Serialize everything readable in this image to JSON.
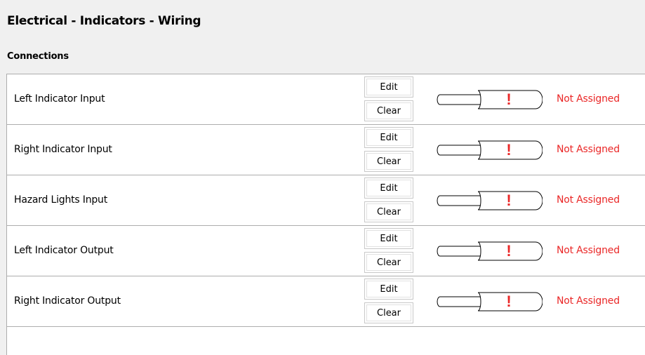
{
  "page": {
    "title": "Electrical - Indicators - Wiring",
    "section_title": "Connections"
  },
  "connections": [
    {
      "label": "Left Indicator Input",
      "edit_label": "Edit",
      "clear_label": "Clear",
      "status": "Not Assigned",
      "status_icon": "!"
    },
    {
      "label": "Right Indicator Input",
      "edit_label": "Edit",
      "clear_label": "Clear",
      "status": "Not Assigned",
      "status_icon": "!"
    },
    {
      "label": "Hazard Lights Input",
      "edit_label": "Edit",
      "clear_label": "Clear",
      "status": "Not Assigned",
      "status_icon": "!"
    },
    {
      "label": "Left Indicator Output",
      "edit_label": "Edit",
      "clear_label": "Clear",
      "status": "Not Assigned",
      "status_icon": "!"
    },
    {
      "label": "Right Indicator Output",
      "edit_label": "Edit",
      "clear_label": "Clear",
      "status": "Not Assigned",
      "status_icon": "!"
    }
  ],
  "colors": {
    "status_unassigned": "#ea2727",
    "border": "#adadad",
    "background": "#f0f0f0"
  },
  "icons": {
    "connector": "plug-connector-icon"
  }
}
